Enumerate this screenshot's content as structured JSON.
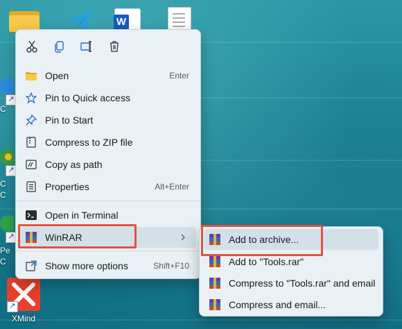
{
  "desktop": {
    "partial_labels": [
      "C",
      "C",
      "C",
      "C",
      "Pe",
      "C"
    ],
    "xmind_label": "XMind",
    "word_letter": "W"
  },
  "context_menu": {
    "items": [
      {
        "label": "Open",
        "shortcut": "Enter",
        "icon": "folder-icon"
      },
      {
        "label": "Pin to Quick access",
        "shortcut": "",
        "icon": "star-icon"
      },
      {
        "label": "Pin to Start",
        "shortcut": "",
        "icon": "pin-icon"
      },
      {
        "label": "Compress to ZIP file",
        "shortcut": "",
        "icon": "zip-icon"
      },
      {
        "label": "Copy as path",
        "shortcut": "",
        "icon": "path-icon"
      },
      {
        "label": "Properties",
        "shortcut": "Alt+Enter",
        "icon": "properties-icon"
      },
      {
        "label": "Open in Terminal",
        "shortcut": "",
        "icon": "terminal-icon"
      },
      {
        "label": "WinRAR",
        "shortcut": "",
        "icon": "winrar-icon"
      },
      {
        "label": "Show more options",
        "shortcut": "Shift+F10",
        "icon": "more-options-icon"
      }
    ]
  },
  "winrar_submenu": {
    "items": [
      {
        "label": "Add to archive..."
      },
      {
        "label": "Add to \"Tools.rar\""
      },
      {
        "label": "Compress to \"Tools.rar\" and email"
      },
      {
        "label": "Compress and email..."
      }
    ]
  },
  "colors": {
    "highlight_box": "#e0533f",
    "menu_bg": "#e9f1f5",
    "desktop_bg": "#167d90"
  }
}
